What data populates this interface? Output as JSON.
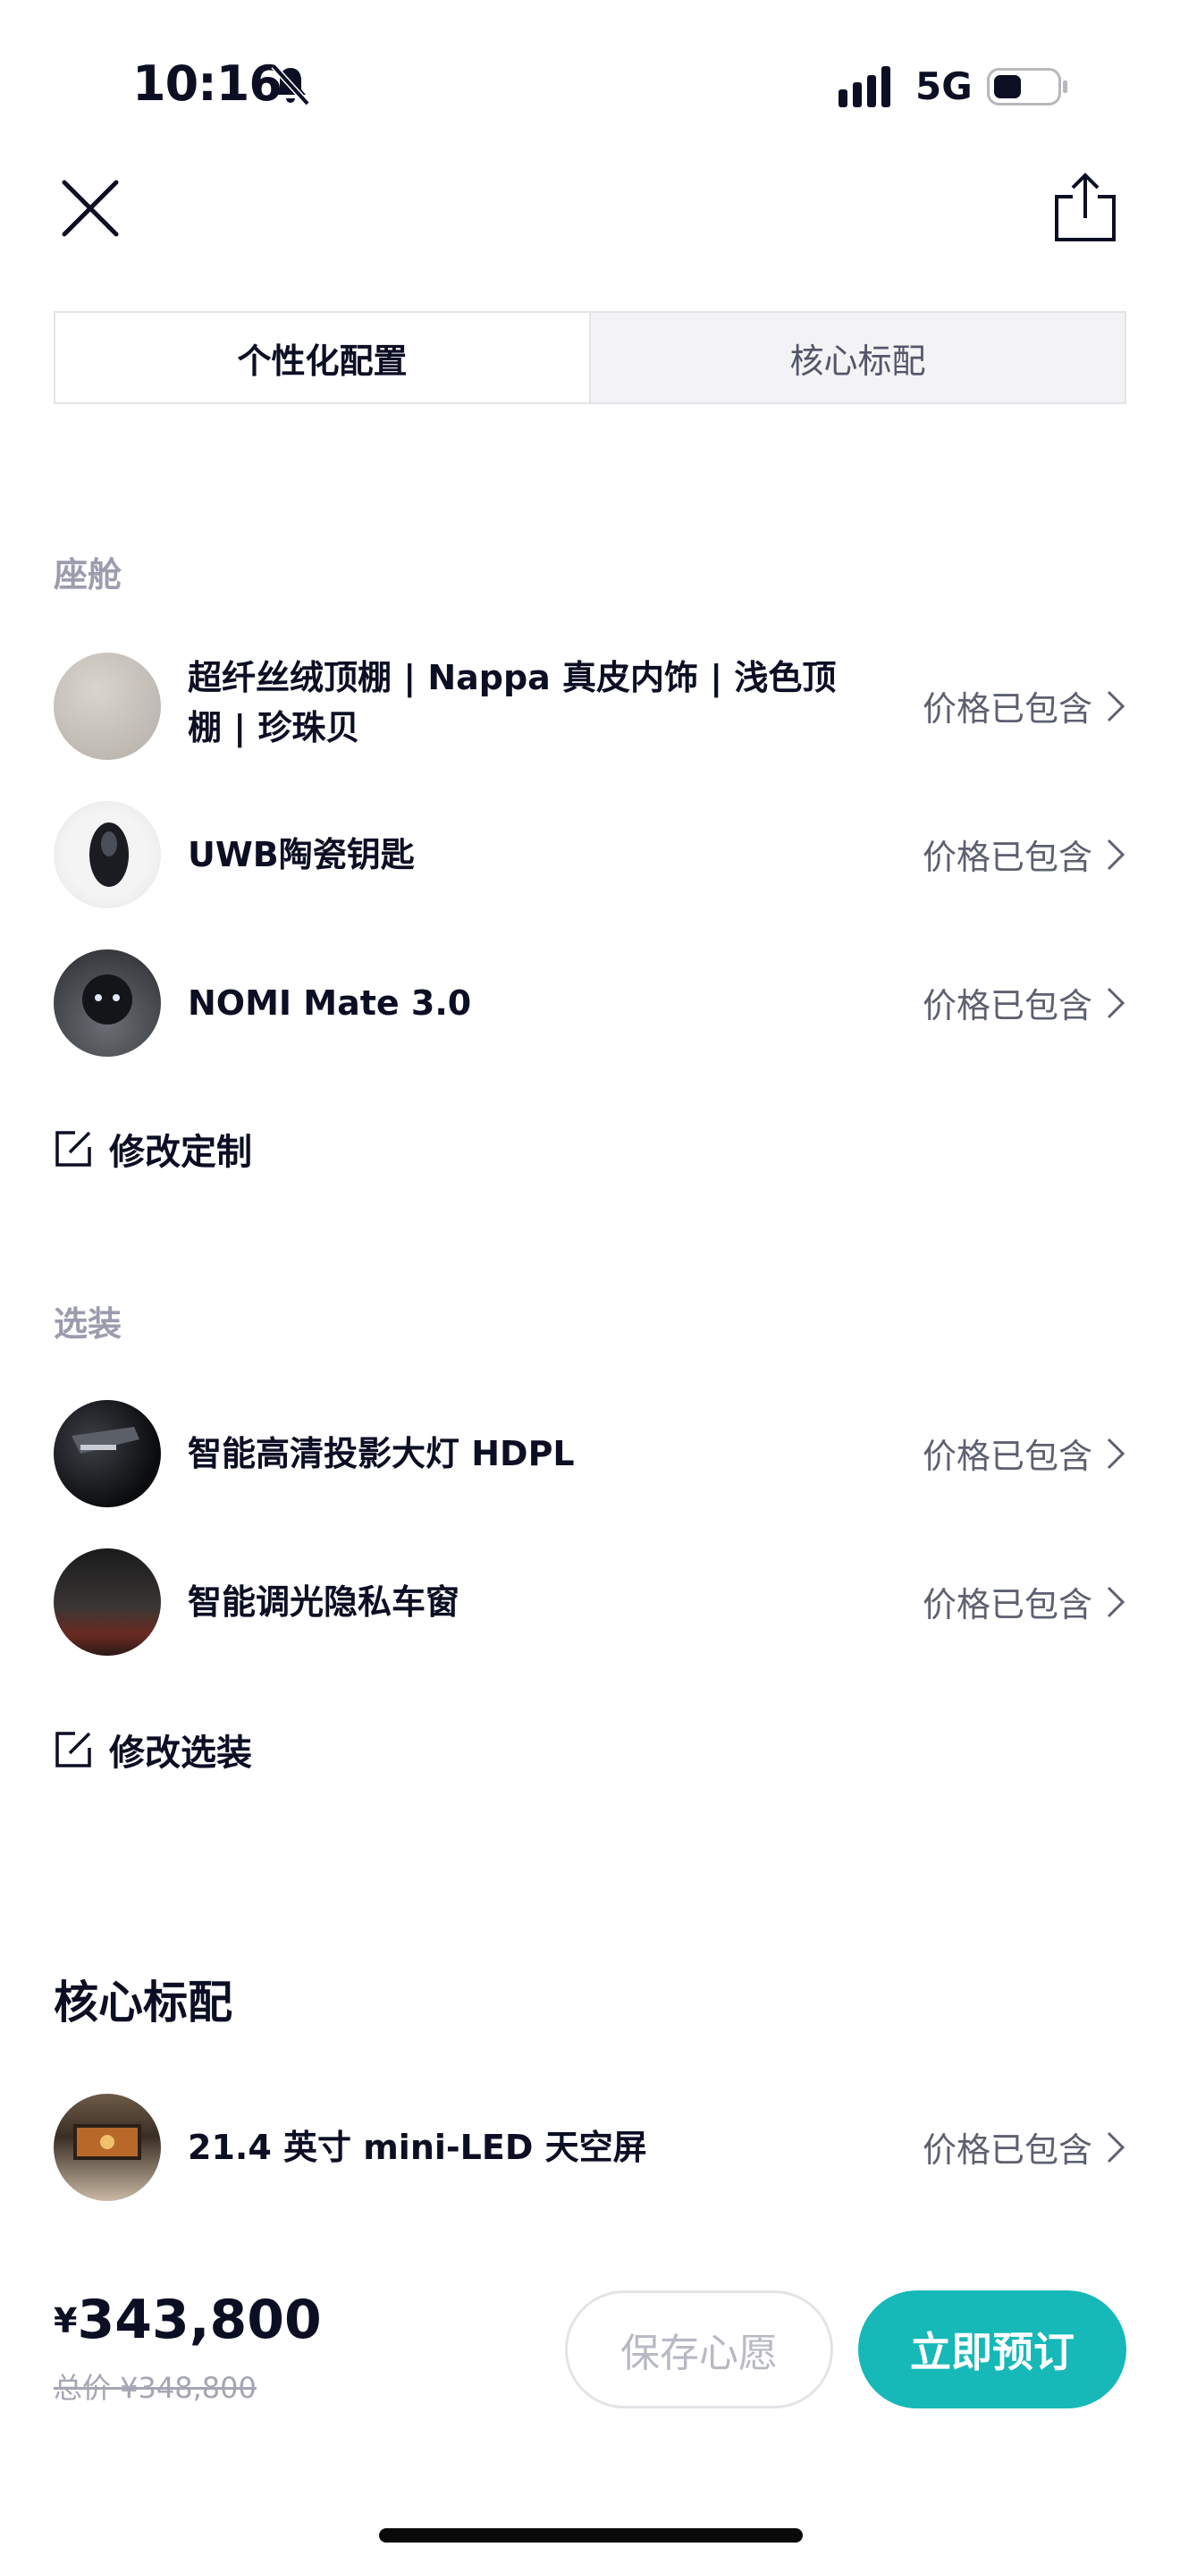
{
  "status_bar": {
    "time": "10:16",
    "network": "5G"
  },
  "tabs": [
    {
      "label": "个性化配置",
      "active": true
    },
    {
      "label": "核心标配",
      "active": false
    }
  ],
  "cabin": {
    "label": "座舱",
    "items": [
      {
        "name_line1": "超纤丝绒顶棚 | Nappa 真皮内饰 | 浅色顶",
        "name_line2": "棚 | 珍珠贝",
        "price": "价格已包含"
      },
      {
        "name": "UWB陶瓷钥匙",
        "price": "价格已包含"
      },
      {
        "name": "NOMI Mate 3.0",
        "price": "价格已包含"
      }
    ],
    "edit_label": "修改定制"
  },
  "options": {
    "label": "选装",
    "items": [
      {
        "name": "智能高清投影大灯 HDPL",
        "price": "价格已包含"
      },
      {
        "name": "智能调光隐私车窗",
        "price": "价格已包含"
      }
    ],
    "edit_label": "修改选装"
  },
  "core": {
    "title": "核心标配",
    "items": [
      {
        "name": "21.4 英寸 mini-LED 天空屏",
        "price": "价格已包含"
      }
    ]
  },
  "footer": {
    "currency": "¥",
    "price": "343,800",
    "original_price": "总价 ¥348,800",
    "wish_label": "保存心愿",
    "order_label": "立即预订"
  },
  "colors": {
    "accent": "#16b8b8",
    "text": "#0c0f24",
    "muted": "#9b9dae"
  },
  "icons": [
    "close-icon",
    "share-icon",
    "bell-slash-icon",
    "signal-icon",
    "battery-icon",
    "chevron-right-icon",
    "edit-icon"
  ]
}
